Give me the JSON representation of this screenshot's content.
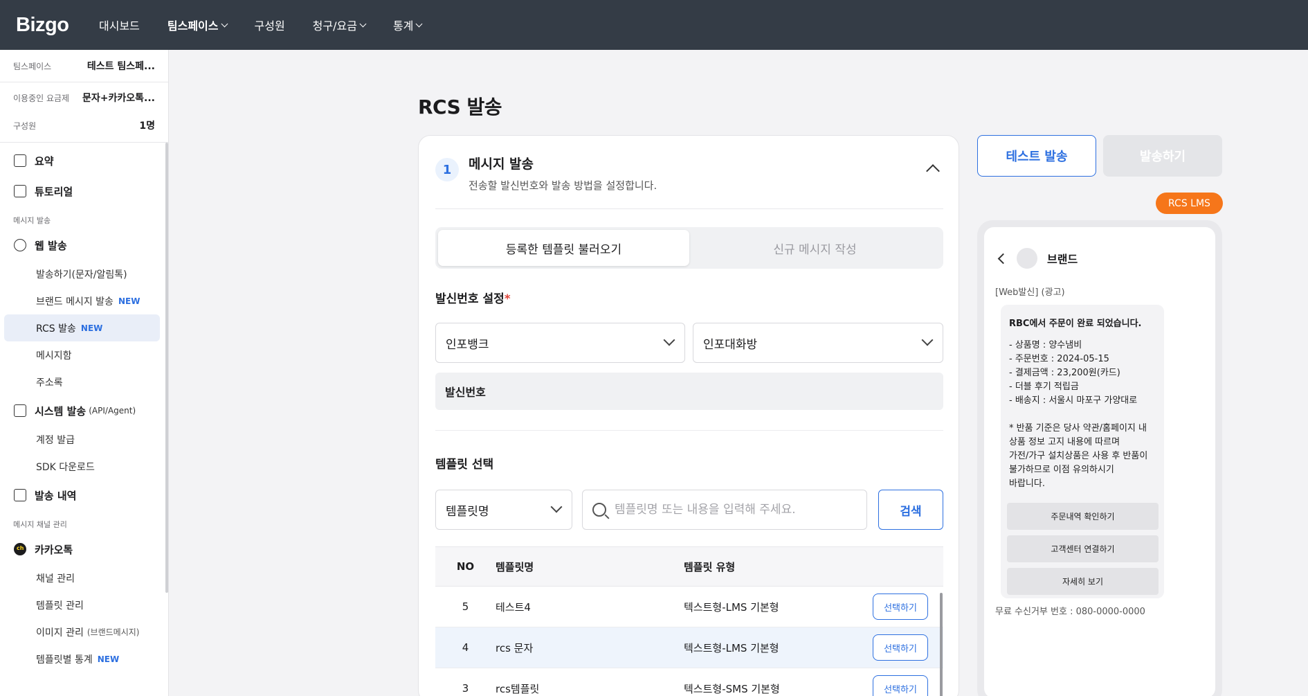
{
  "nav": {
    "logo": "Bizgo",
    "items": [
      {
        "label": "대시보드",
        "dropdown": false,
        "bold": false
      },
      {
        "label": "팀스페이스",
        "dropdown": true,
        "bold": true
      },
      {
        "label": "구성원",
        "dropdown": false,
        "bold": false
      },
      {
        "label": "청구/요금",
        "dropdown": true,
        "bold": false
      },
      {
        "label": "통계",
        "dropdown": true,
        "bold": false
      }
    ]
  },
  "sidebar": {
    "teamspace_label": "팀스페이스",
    "teamspace_value": "테스트 팀스페...",
    "plan_label": "이용중인 요금제",
    "plan_value": "문자+카카오톡...",
    "members_label": "구성원",
    "members_value": "1명",
    "summary": "요약",
    "tutorial": "튜토리얼",
    "group_message": "메시지 발송",
    "web_send": "웹 발송",
    "web_items": [
      {
        "label": "발송하기(문자/알림톡)",
        "new": ""
      },
      {
        "label": "브랜드 메시지 발송",
        "new": "NEW"
      },
      {
        "label": "RCS 발송",
        "new": "NEW"
      },
      {
        "label": "메시지함",
        "new": ""
      },
      {
        "label": "주소록",
        "new": ""
      }
    ],
    "system_send": "시스템 발송",
    "system_send_sub": "(API/Agent)",
    "system_items": [
      "계정 발급",
      "SDK 다운로드"
    ],
    "history": "발송 내역",
    "group_channel": "메시지 채널 관리",
    "kakao": "카카오톡",
    "kakao_items": [
      {
        "label": "채널 관리",
        "small": "",
        "new": ""
      },
      {
        "label": "템플릿 관리",
        "small": "",
        "new": ""
      },
      {
        "label": "이미지 관리",
        "small": "(브랜드메시지)",
        "new": ""
      },
      {
        "label": "템플릿별 통계",
        "small": "",
        "new": "NEW"
      }
    ]
  },
  "main": {
    "page_title": "RCS 발송",
    "step_number": "1",
    "step_title": "메시지 발송",
    "step_desc": "전송할 발신번호와 발송 방법을 설정합니다.",
    "tabs": [
      "등록한 템플릿 불러오기",
      "신규 메시지 작성"
    ],
    "sender_label": "발신번호 설정",
    "required_mark": "*",
    "sender_select_1": "인포뱅크",
    "sender_select_2": "인포대화방",
    "sender_number_label": "발신번호",
    "template_label": "템플릿 선택",
    "template_filter": "템플릿명",
    "search_placeholder": "템플릿명 또는 내용을 입력해 주세요.",
    "search_button": "검색",
    "table_headers": {
      "no": "NO",
      "name": "템플릿명",
      "type": "템플릿 유형"
    },
    "rows": [
      {
        "no": "5",
        "name": "테스트4",
        "type": "텍스트형-LMS 기본형",
        "action": "선택하기"
      },
      {
        "no": "4",
        "name": "rcs 문자",
        "type": "텍스트형-LMS 기본형",
        "action": "선택하기"
      },
      {
        "no": "3",
        "name": "rcs템플릿",
        "type": "텍스트형-SMS 기본형",
        "action": "선택하기"
      }
    ]
  },
  "actions": {
    "test_send": "테스트 발송",
    "send": "발송하기"
  },
  "preview": {
    "badge": "RCS LMS",
    "brand": "브랜드",
    "prefix": "[Web발신] (광고)",
    "title": "RBC에서 주문이 완료 되었습니다.",
    "lines": [
      "- 상품명 : 양수냄비",
      "- 주문번호 : 2024-05-15",
      "- 결제금액 : 23,200원(카드)",
      "- 더블 후기 적립금",
      "- 배송지 : 서울시 마포구 가양대로"
    ],
    "notice": [
      "* 반품 기준은 당사 약관/홈페이지 내",
      "상품 정보 고지 내용에 따르며",
      "가전/가구 설치상품은 사용 후 반품이",
      "불가하므로 이점 유의하시기",
      "바랍니다."
    ],
    "buttons": [
      "주문내역 확인하기",
      "고객센터 연결하기",
      "자세히 보기"
    ],
    "footer": "무료 수신거부 번호 : 080-0000-0000"
  },
  "colors": {
    "topbar": "#343c46",
    "accent": "#2c6fe0",
    "badge": "#f6761a"
  }
}
